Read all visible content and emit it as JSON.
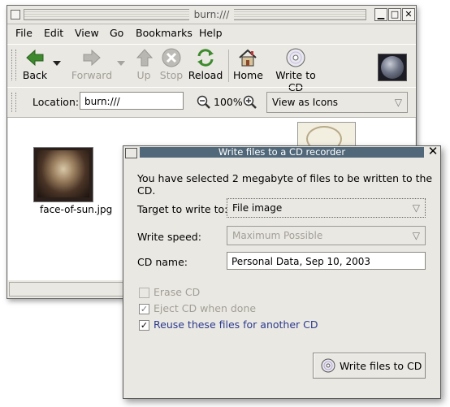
{
  "window": {
    "title": "burn:///",
    "menu": [
      "File",
      "Edit",
      "View",
      "Go",
      "Bookmarks",
      "Help"
    ],
    "toolbar": {
      "back": "Back",
      "forward": "Forward",
      "up": "Up",
      "stop": "Stop",
      "reload": "Reload",
      "home": "Home",
      "write": "Write to CD"
    },
    "location_label": "Location:",
    "location_value": "burn:///",
    "zoom": "100%",
    "view_mode": "View as Icons",
    "files": [
      "face-of-sun.jpg"
    ]
  },
  "dialog": {
    "title": "Write files to a CD recorder",
    "message": "You have selected 2 megabyte of files to be written to the CD.",
    "target_label": "Target to write to:",
    "target_value": "File image",
    "speed_label": "Write speed:",
    "speed_value": "Maximum Possible",
    "name_label": "CD name:",
    "name_value": "Personal Data, Sep 10, 2003",
    "erase": "Erase CD",
    "eject": "Eject CD when done",
    "reuse": "Reuse these files for another CD",
    "write_button": "Write files to CD"
  },
  "colors": {
    "title_bar": "#51687a",
    "background": "#eae8e3"
  }
}
